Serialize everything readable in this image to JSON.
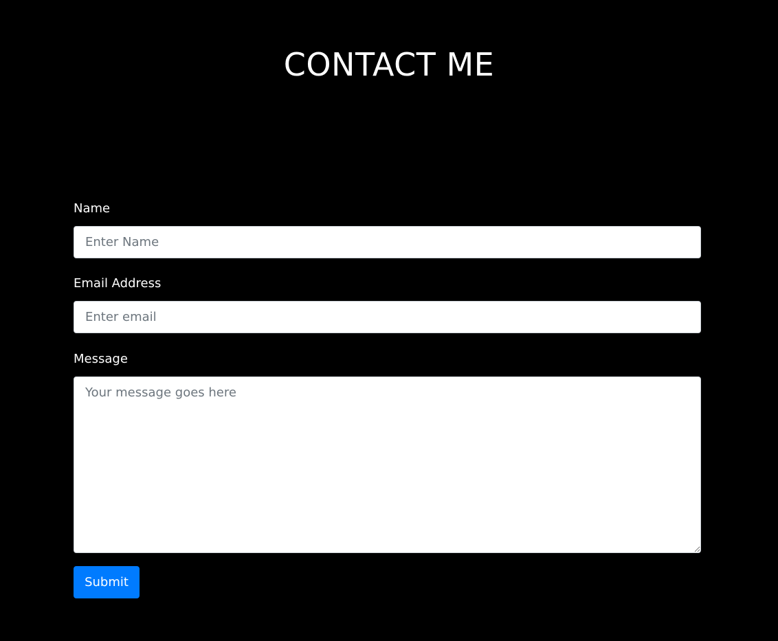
{
  "header": {
    "title": "CONTACT ME"
  },
  "form": {
    "name": {
      "label": "Name",
      "placeholder": "Enter Name",
      "value": ""
    },
    "email": {
      "label": "Email Address",
      "placeholder": "Enter email",
      "value": ""
    },
    "message": {
      "label": "Message",
      "placeholder": "Your message goes here",
      "value": ""
    },
    "submit_label": "Submit"
  },
  "colors": {
    "background": "#000000",
    "text": "#ffffff",
    "accent": "#007bff",
    "input_background": "#ffffff",
    "placeholder": "#6c757d"
  }
}
